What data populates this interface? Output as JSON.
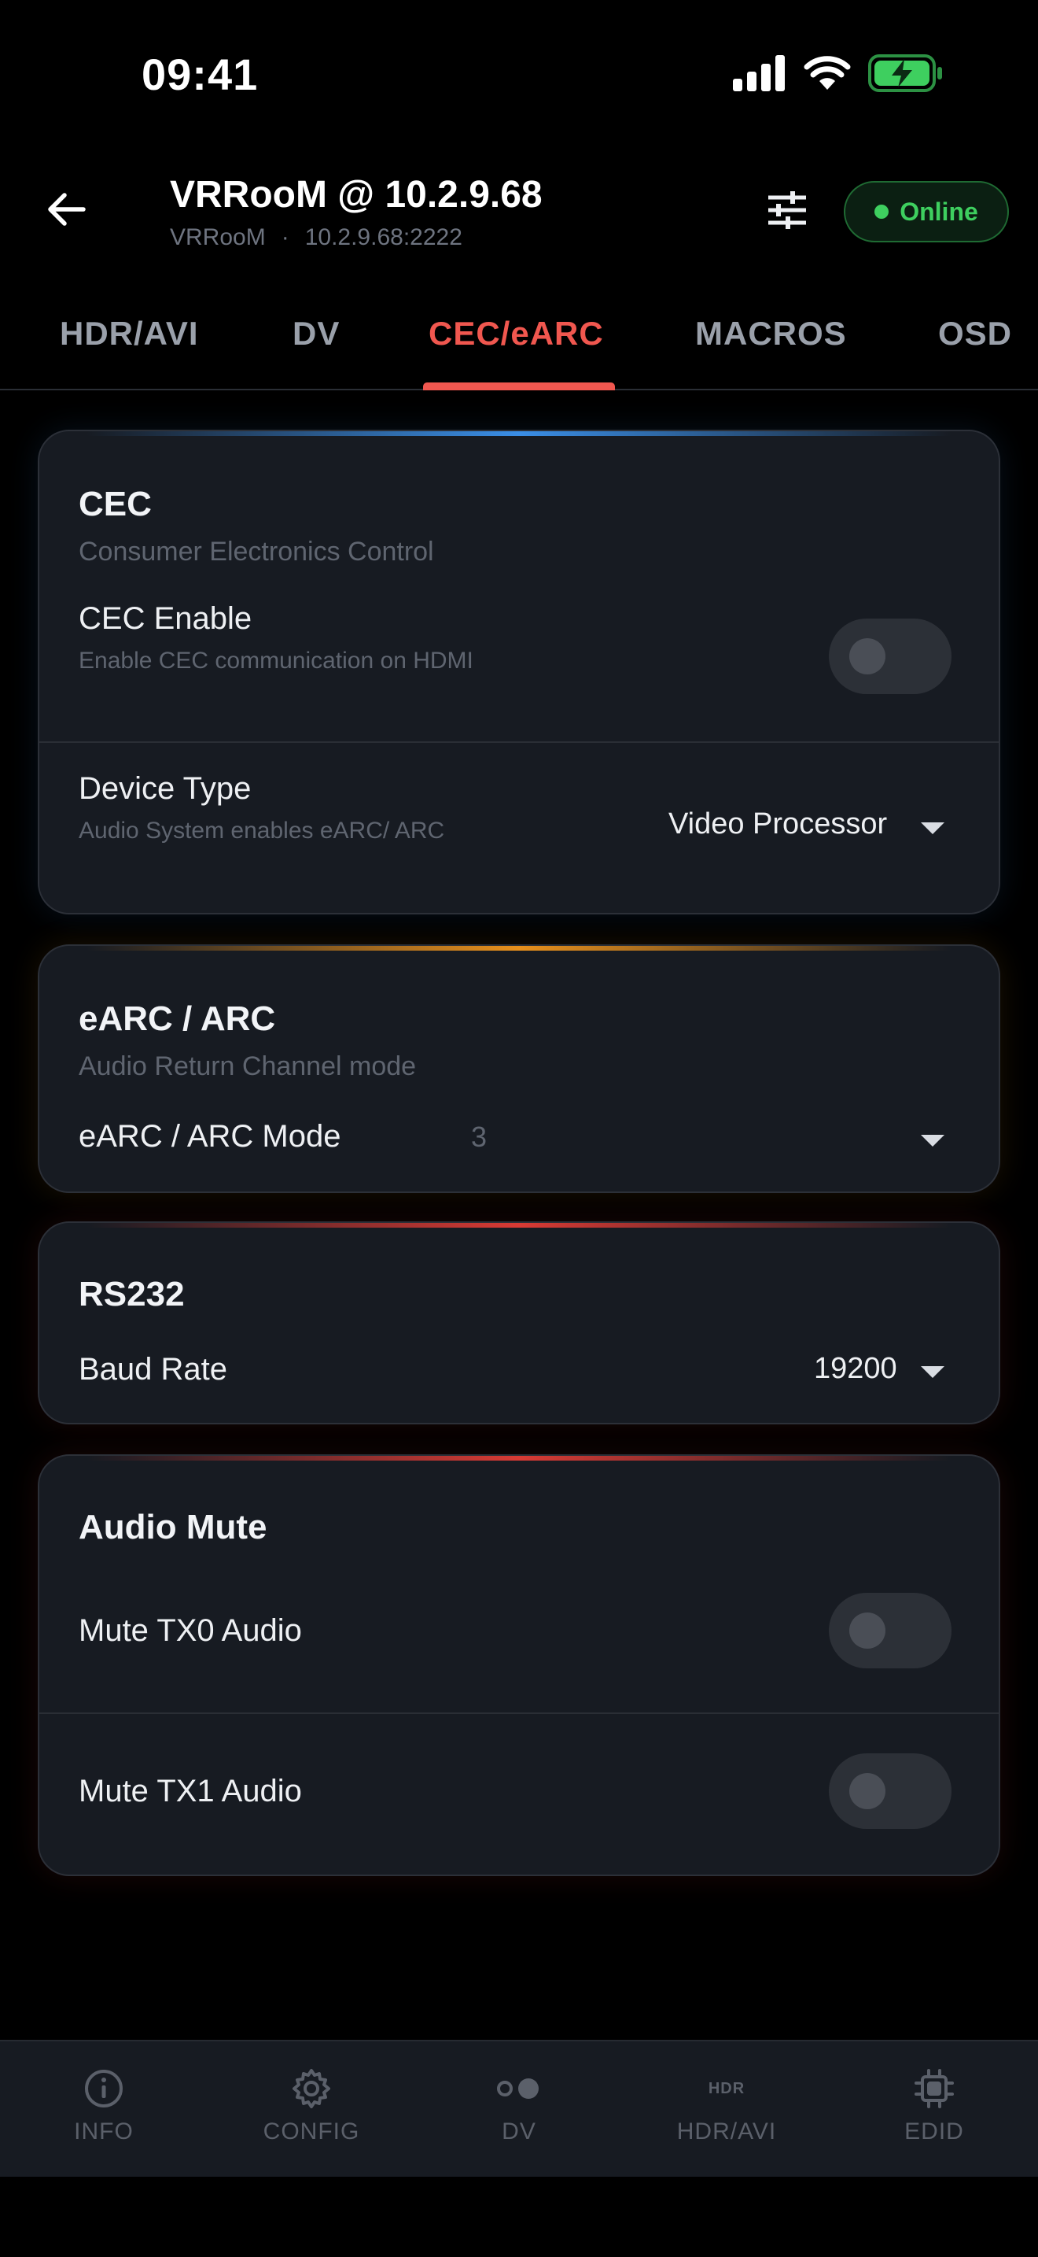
{
  "status_bar": {
    "time": "09:41"
  },
  "header": {
    "title": "VRRooM @ 10.2.9.68",
    "subtitle_name": "VRRooM",
    "subtitle_sep": "·",
    "subtitle_addr": "10.2.9.68:2222",
    "status": "Online"
  },
  "tabs": [
    {
      "label": "HDR/AVI"
    },
    {
      "label": "DV"
    },
    {
      "label": "CEC/eARC",
      "active": true
    },
    {
      "label": "MACROS"
    },
    {
      "label": "OSD"
    }
  ],
  "cec": {
    "title": "CEC",
    "subtitle": "Consumer Electronics Control",
    "enable_label": "CEC Enable",
    "enable_desc": "Enable CEC communication on HDMI",
    "enable_on": false,
    "device_type_label": "Device Type",
    "device_type_desc": "Audio System enables eARC/ ARC",
    "device_type_value": "Video Processor",
    "accent": "#3a8ee6"
  },
  "earc": {
    "title": "eARC / ARC",
    "subtitle": "Audio Return Channel mode",
    "mode_label": "eARC / ARC Mode",
    "mode_value": "3",
    "accent": "#e8901c"
  },
  "rs232": {
    "title": "RS232",
    "baud_label": "Baud Rate",
    "baud_value": "19200",
    "accent": "#d83a34"
  },
  "audio_mute": {
    "title": "Audio Mute",
    "tx0_label": "Mute TX0 Audio",
    "tx0_on": false,
    "tx1_label": "Mute TX1 Audio",
    "tx1_on": false,
    "accent": "#d83a34"
  },
  "bottom_nav": [
    {
      "label": "INFO",
      "icon": "info-icon"
    },
    {
      "label": "CONFIG",
      "icon": "gear-icon"
    },
    {
      "label": "DV",
      "icon": "dv-icon"
    },
    {
      "label": "HDR/AVI",
      "icon": "hdr-icon",
      "icon_text": "HDR"
    },
    {
      "label": "EDID",
      "icon": "chip-icon"
    }
  ]
}
